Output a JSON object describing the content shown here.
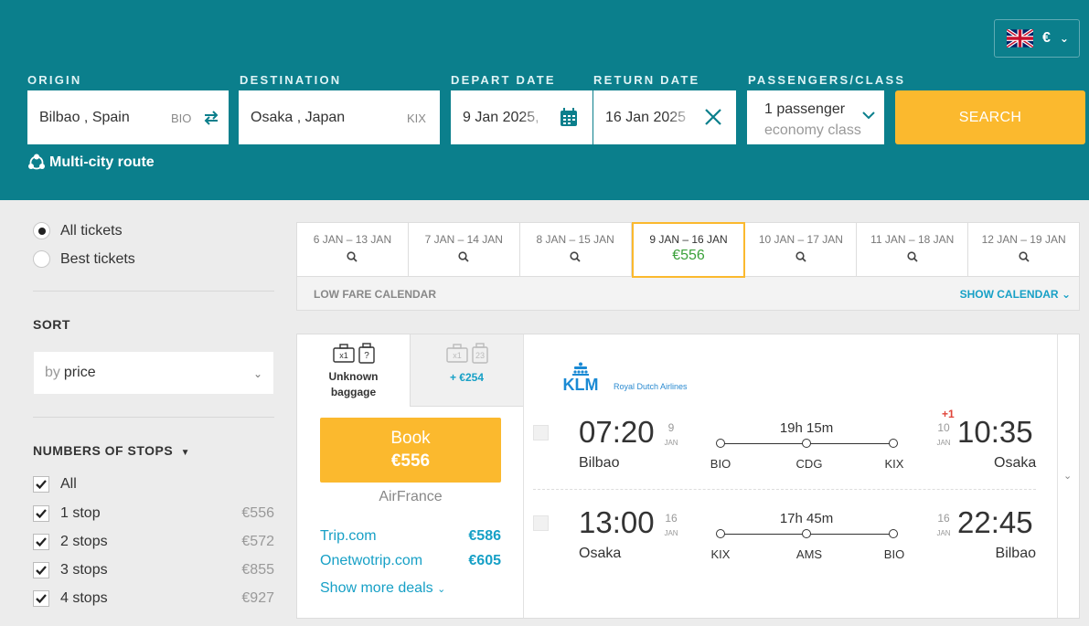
{
  "header": {
    "currency": "€",
    "fields": {
      "origin": {
        "label": "ORIGIN",
        "value": "Bilbao , Spain",
        "code": "BIO"
      },
      "destination": {
        "label": "DESTINATION",
        "value": "Osaka , Japan",
        "code": "KIX"
      },
      "depart": {
        "label": "DEPART DATE",
        "value": "9 Jan 2025,"
      },
      "return": {
        "label": "RETURN DATE",
        "value": "16 Jan 2025"
      },
      "passengers": {
        "label": "PASSENGERS/CLASS",
        "count": "1 passenger",
        "class": "economy class"
      }
    },
    "search_label": "SEARCH",
    "multicity_label": "Multi-city route"
  },
  "sidebar": {
    "ticket_filter": [
      {
        "label": "All tickets",
        "selected": true
      },
      {
        "label": "Best tickets",
        "selected": false
      }
    ],
    "sort_title": "SORT",
    "sort_by": "by",
    "sort_value": "price",
    "stops_title": "NUMBERS OF STOPS",
    "stops": [
      {
        "label": "All",
        "price": "",
        "checked": true
      },
      {
        "label": "1 stop",
        "price": "€556",
        "checked": true
      },
      {
        "label": "2 stops",
        "price": "€572",
        "checked": true
      },
      {
        "label": "3 stops",
        "price": "€855",
        "checked": true
      },
      {
        "label": "4 stops",
        "price": "€927",
        "checked": true
      }
    ]
  },
  "date_strip": {
    "cells": [
      {
        "range": "6 JAN – 13 JAN",
        "price": ""
      },
      {
        "range": "7 JAN – 14 JAN",
        "price": ""
      },
      {
        "range": "8 JAN – 15 JAN",
        "price": ""
      },
      {
        "range": "9 JAN – 16 JAN",
        "price": "€556",
        "selected": true
      },
      {
        "range": "10 JAN – 17 JAN",
        "price": ""
      },
      {
        "range": "11 JAN – 18 JAN",
        "price": ""
      },
      {
        "range": "12 JAN – 19 JAN",
        "price": ""
      }
    ],
    "low_fare_label": "LOW FARE CALENDAR",
    "show_calendar_label": "SHOW CALENDAR"
  },
  "result": {
    "baggage_tab1": {
      "line1": "Unknown",
      "line2": "baggage",
      "icon1": "x1",
      "icon2": "?"
    },
    "baggage_tab2": {
      "price": "+ €254",
      "icon1": "x1",
      "icon2": "23"
    },
    "book_label": "Book",
    "book_price": "€556",
    "agent": "AirFrance",
    "deals": [
      {
        "name": "Trip.com",
        "price": "€586"
      },
      {
        "name": "Onetwotrip.com",
        "price": "€605"
      }
    ],
    "more_deals_label": "Show more deals",
    "airline": {
      "name": "KLM",
      "subtitle": "Royal Dutch Airlines"
    },
    "legs": [
      {
        "dep_time": "07:20",
        "dep_day": "9",
        "dep_mon": "JAN",
        "dep_city": "Bilbao",
        "arr_time": "10:35",
        "arr_day": "10",
        "arr_mon": "JAN",
        "arr_city": "Osaka",
        "duration": "19h 15m",
        "next_day": "+1",
        "airports": [
          "BIO",
          "CDG",
          "KIX"
        ]
      },
      {
        "dep_time": "13:00",
        "dep_day": "16",
        "dep_mon": "JAN",
        "dep_city": "Osaka",
        "arr_time": "22:45",
        "arr_day": "16",
        "arr_mon": "JAN",
        "arr_city": "Bilbao",
        "duration": "17h 45m",
        "next_day": "",
        "airports": [
          "KIX",
          "AMS",
          "BIO"
        ]
      }
    ]
  },
  "colors": {
    "header_bg": "#0b7f8c",
    "accent_orange": "#fbb92e",
    "link_blue": "#17a0c6",
    "price_green": "#3aa13a"
  }
}
